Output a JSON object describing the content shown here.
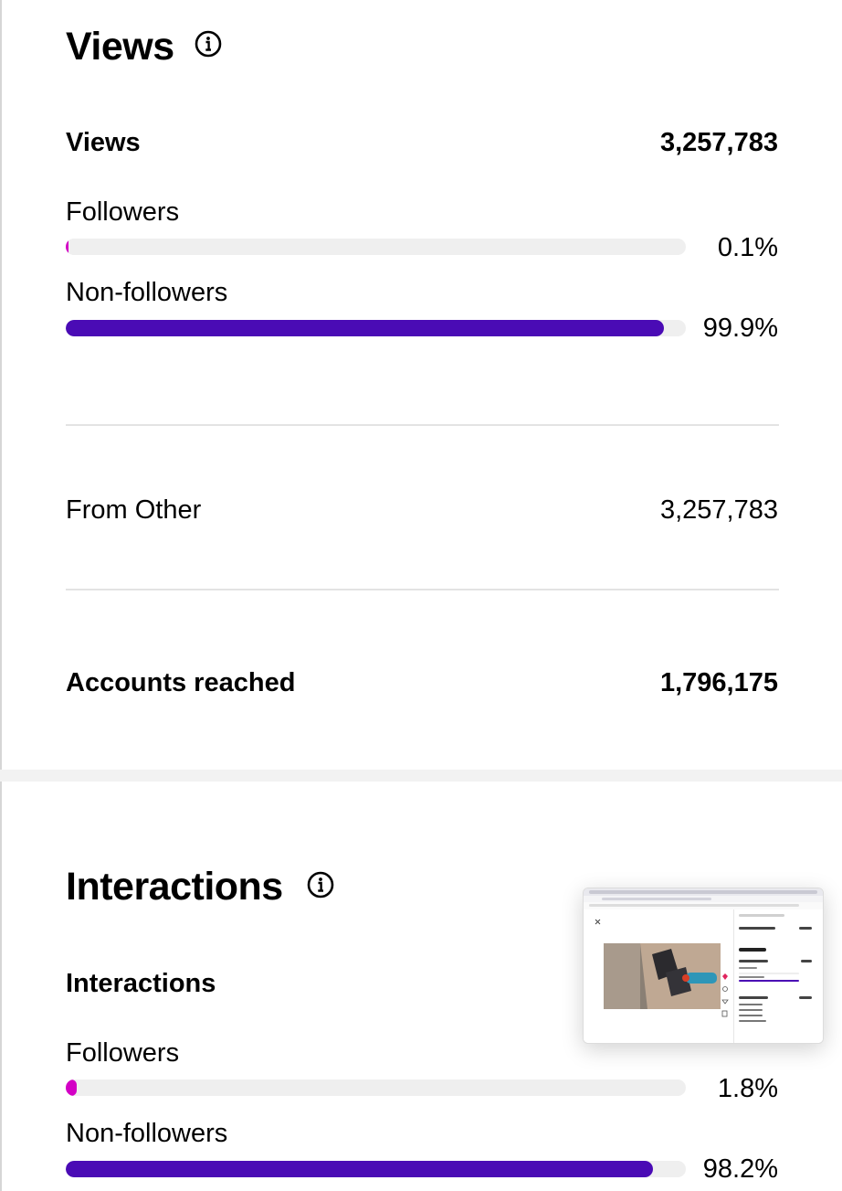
{
  "views_section": {
    "title": "Views",
    "total_label": "Views",
    "total_value": "3,257,783",
    "followers_label": "Followers",
    "followers_percent": "0.1%",
    "followers_fraction": 0.001,
    "nonfollowers_label": "Non-followers",
    "nonfollowers_percent": "99.9%",
    "nonfollowers_fraction": 0.999,
    "source_label": "From Other",
    "source_value": "3,257,783",
    "reach_label": "Accounts reached",
    "reach_value": "1,796,175"
  },
  "interactions_section": {
    "title": "Interactions",
    "total_label": "Interactions",
    "followers_label": "Followers",
    "followers_percent": "1.8%",
    "followers_fraction": 0.018,
    "nonfollowers_label": "Non-followers",
    "nonfollowers_percent": "98.2%",
    "nonfollowers_fraction": 0.982
  },
  "icons": {
    "views_info": "info-icon",
    "interactions_info": "info-icon"
  },
  "colors": {
    "followers_bar": "#d300c5",
    "nonfollowers_bar": "#4a0bb5",
    "bar_track": "#efefef"
  }
}
